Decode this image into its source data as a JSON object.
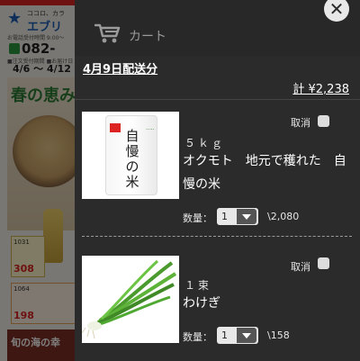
{
  "background": {
    "logo_sub": "ココロ、カラ",
    "logo_name": "エブリ",
    "info": "お電話受付時間 9:00〜",
    "phone": "082-",
    "order_note": "■注文受付期間 ■お届け日",
    "dates": "4/6 〜 4/12",
    "hero_title": "春の恵み",
    "promo1_price": "308",
    "promo1_code": "1031",
    "promo2_price": "198",
    "promo2_code": "1064",
    "footer_text": "旬の海の幸"
  },
  "cart": {
    "title": "カート",
    "close_symbol": "✕",
    "delivery_label": "4月9日配送分",
    "total_label": "計 ¥2,238",
    "items": [
      {
        "image": "rice-bag",
        "image_text": "自慢の米",
        "cancel_label": "取消",
        "spec": "５ｋｇ",
        "name": "オクモト　地元で穫れた　自慢の米",
        "qty_label": "数量：",
        "qty": "1",
        "price": "\\2,080"
      },
      {
        "image": "green-onion",
        "cancel_label": "取消",
        "spec": "１束",
        "name": "わけぎ",
        "qty_label": "数量：",
        "qty": "1",
        "price": "\\158"
      }
    ]
  },
  "colors": {
    "panel_bg": "#2b2b2b",
    "text_primary": "#ffffff",
    "text_muted": "#9a9a9a"
  }
}
